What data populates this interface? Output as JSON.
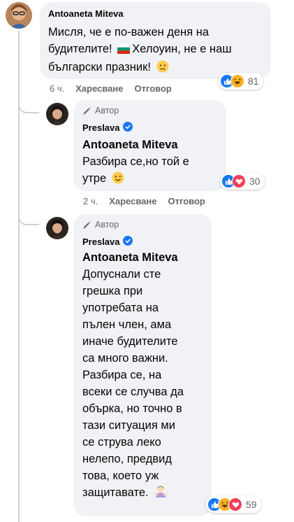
{
  "comments": [
    {
      "author": "Antoaneta Miteva",
      "text_line1": "Мисля, че е по-важен деня на",
      "text_line2a": "будителите!",
      "text_line2b": "Хелоуин, не е наш",
      "text_line3": "български празник!",
      "time": "6 ч.",
      "like_label": "Харесване",
      "reply_label": "Отговор",
      "reaction_count": "81",
      "reaction_icons": [
        "like-icon",
        "haha-icon"
      ]
    },
    {
      "author_badge": "Автор",
      "author": "Preslava",
      "mention": "Antoaneta Miteva",
      "text_line1": "Разбира се,но той е",
      "text_line2": "утре",
      "time": "2 ч.",
      "like_label": "Харесване",
      "reply_label": "Отговор",
      "reaction_count": "30",
      "reaction_icons": [
        "like-icon",
        "love-icon"
      ]
    },
    {
      "author_badge": "Автор",
      "author": "Preslava",
      "mention": "Antoaneta Miteva",
      "lines": [
        "Допуснали сте",
        "грешка при",
        "употребата на",
        "пълен член, ама",
        "иначе будителите",
        "са много важни.",
        "Разбира се, на",
        "всеки се случва да",
        "обърка, но точно в",
        "тази ситуация ми",
        "се струва леко",
        "нелепо, предвид",
        "това, което уж",
        "защитавате."
      ],
      "reaction_count": "59",
      "reaction_icons": [
        "like-icon",
        "haha-icon",
        "love-icon"
      ]
    }
  ],
  "colors": {
    "like_blue": "#1877f2",
    "love_red": "#f33e58",
    "haha_yellow": "#f7b125",
    "bubble_bg": "#f0f2f5",
    "meta_gray": "#65676b"
  }
}
